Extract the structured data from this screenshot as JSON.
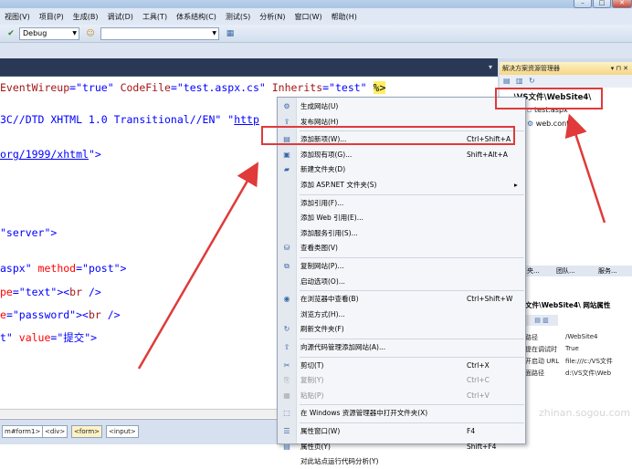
{
  "menubar": {
    "items": [
      "视图(V)",
      "项目(P)",
      "生成(B)",
      "调试(D)",
      "工具(T)",
      "体系结构(C)",
      "测试(S)",
      "分析(N)",
      "窗口(W)",
      "帮助(H)"
    ]
  },
  "toolbar": {
    "config_value": "Debug"
  },
  "code": {
    "lines": [
      {
        "parts": [
          {
            "c": "r",
            "t": "EventWireup"
          },
          {
            "c": "b",
            "t": "=\"true\" "
          },
          {
            "c": "r",
            "t": "CodeFile"
          },
          {
            "c": "b",
            "t": "=\"test.aspx.cs\" "
          },
          {
            "c": "r",
            "t": "Inherits"
          },
          {
            "c": "b",
            "t": "=\"test\" "
          },
          {
            "c": "hl",
            "t": "%>"
          }
        ]
      },
      {
        "parts": [
          {
            "c": "b",
            "t": "3C//DTD XHTML 1.0 Transitional//EN\" \""
          },
          {
            "c": "ul",
            "t": "http"
          }
        ]
      },
      {
        "parts": [
          {
            "c": "ul",
            "t": "org/1999/xhtml"
          },
          {
            "c": "b",
            "t": "\">"
          }
        ]
      },
      {
        "parts": [
          {
            "c": "b",
            "t": "\"server\">"
          }
        ]
      },
      {
        "parts": [
          {
            "c": "b",
            "t": "aspx\" "
          },
          {
            "c": "red",
            "t": "method"
          },
          {
            "c": "b",
            "t": "=\"post\">"
          }
        ]
      },
      {
        "parts": [
          {
            "c": "red",
            "t": "pe"
          },
          {
            "c": "b",
            "t": "=\"text\"><"
          },
          {
            "c": "r",
            "t": "br"
          },
          {
            "c": "b",
            "t": " />"
          }
        ]
      },
      {
        "parts": [
          {
            "c": "red",
            "t": "e"
          },
          {
            "c": "b",
            "t": "=\"password\"><"
          },
          {
            "c": "r",
            "t": "br"
          },
          {
            "c": "b",
            "t": " />"
          }
        ]
      },
      {
        "parts": [
          {
            "c": "b",
            "t": "t\" "
          },
          {
            "c": "red",
            "t": "value"
          },
          {
            "c": "b",
            "t": "=\"提交\">"
          }
        ]
      }
    ]
  },
  "status_path": [
    "m#form1>",
    "<div>",
    "<form>",
    "<input>"
  ],
  "solution_explorer": {
    "title": "解决方案资源管理器",
    "root": "...\\VS文件\\WebSite4\\",
    "items": [
      "test.aspx",
      "web.config"
    ]
  },
  "tabs": {
    "a": "央...",
    "b": "团队...",
    "c": "服务..."
  },
  "properties": {
    "title": "文件\\WebSite4\\ 网站属性",
    "rows": [
      {
        "k": "路径",
        "v": "/WebSite4"
      },
      {
        "k": "提在调试时",
        "v": "True"
      },
      {
        "k": "开启动 URL",
        "v": "file:///c:/VS文件"
      },
      {
        "k": "面路径",
        "v": "d:\\VS文件\\Web"
      }
    ]
  },
  "context_menu": [
    {
      "label": "生成网站(U)",
      "shortcut": "",
      "icon": "build-icon",
      "disabled": false
    },
    {
      "label": "发布网站(H)",
      "shortcut": "",
      "icon": "publish-icon",
      "disabled": false
    },
    {
      "sep": true
    },
    {
      "label": "添加新项(W)...",
      "shortcut": "Ctrl+Shift+A",
      "icon": "add-new-item-icon",
      "disabled": false
    },
    {
      "label": "添加现有项(G)...",
      "shortcut": "Shift+Alt+A",
      "icon": "add-existing-item-icon",
      "disabled": false
    },
    {
      "label": "新建文件夹(D)",
      "shortcut": "",
      "icon": "new-folder-icon",
      "disabled": false
    },
    {
      "label": "添加 ASP.NET 文件夹(S)",
      "shortcut": "",
      "icon": "",
      "disabled": false,
      "submenu": true
    },
    {
      "sep": true
    },
    {
      "label": "添加引用(F)...",
      "shortcut": "",
      "icon": "",
      "disabled": false
    },
    {
      "label": "添加 Web 引用(E)...",
      "shortcut": "",
      "icon": "",
      "disabled": false
    },
    {
      "label": "添加服务引用(S)...",
      "shortcut": "",
      "icon": "",
      "disabled": false
    },
    {
      "label": "查看类图(V)",
      "shortcut": "",
      "icon": "class-diagram-icon",
      "disabled": false
    },
    {
      "sep": true
    },
    {
      "label": "复制网站(P)...",
      "shortcut": "",
      "icon": "copy-site-icon",
      "disabled": false
    },
    {
      "label": "启动选项(O)...",
      "shortcut": "",
      "icon": "",
      "disabled": false
    },
    {
      "sep": true
    },
    {
      "label": "在浏览器中查看(B)",
      "shortcut": "Ctrl+Shift+W",
      "icon": "browser-icon",
      "disabled": false
    },
    {
      "label": "浏览方式(H)...",
      "shortcut": "",
      "icon": "",
      "disabled": false
    },
    {
      "label": "刷新文件夹(F)",
      "shortcut": "",
      "icon": "refresh-icon",
      "disabled": false
    },
    {
      "sep": true
    },
    {
      "label": "向源代码管理添加网站(A)...",
      "shortcut": "",
      "icon": "source-control-icon",
      "disabled": false
    },
    {
      "sep": true
    },
    {
      "label": "剪切(T)",
      "shortcut": "Ctrl+X",
      "icon": "cut-icon",
      "disabled": false
    },
    {
      "label": "复制(Y)",
      "shortcut": "Ctrl+C",
      "icon": "copy-icon",
      "disabled": true
    },
    {
      "label": "粘贴(P)",
      "shortcut": "Ctrl+V",
      "icon": "paste-icon",
      "disabled": true
    },
    {
      "sep": true
    },
    {
      "label": "在 Windows 资源管理器中打开文件夹(X)",
      "shortcut": "",
      "icon": "open-folder-icon",
      "disabled": false
    },
    {
      "sep": true
    },
    {
      "label": "属性窗口(W)",
      "shortcut": "F4",
      "icon": "properties-window-icon",
      "disabled": false
    },
    {
      "label": "属性页(Y)",
      "shortcut": "Shift+F4",
      "icon": "property-pages-icon",
      "disabled": false
    },
    {
      "label": "对此站点运行代码分析(Y)",
      "shortcut": "",
      "icon": "",
      "disabled": false
    }
  ],
  "watermark": {
    "site": "zhinan.sogou.com"
  },
  "colors": {
    "annotation": "#e03a3a",
    "highlight": "#ffee62"
  }
}
